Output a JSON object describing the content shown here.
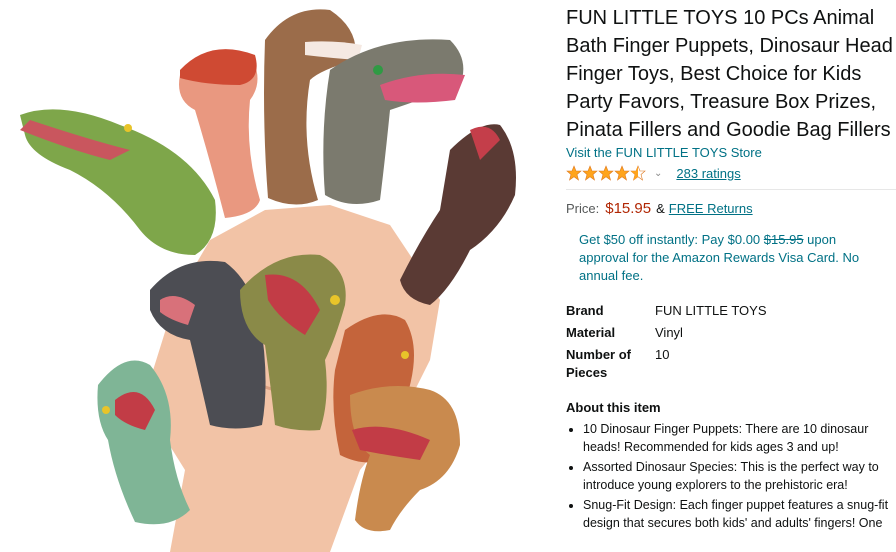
{
  "product": {
    "title": "FUN LITTLE TOYS 10 PCs Animal Bath Finger Puppets, Dinosaur Head Finger Toys, Best Choice for Kids Party Favors, Treasure Box Prizes, Pinata Fillers and Goodie Bag Fillers",
    "store_link": "Visit the FUN LITTLE TOYS Store",
    "rating": 4.5,
    "ratings_count": "283 ratings",
    "chevron_icon": "chevron-down-icon",
    "star_color": "#ffa41c"
  },
  "price": {
    "label": "Price:",
    "amount": "$15.95",
    "amp": "&",
    "returns": "FREE Returns",
    "color": "#b12704"
  },
  "promo": {
    "part1": "Get $50 off instantly: Pay $0.00",
    "strike": "$15.95",
    "part2": "upon approval for the Amazon Rewards Visa Card. No annual fee."
  },
  "specs": [
    {
      "label": "Brand",
      "value": "FUN LITTLE TOYS"
    },
    {
      "label": "Material",
      "value": "Vinyl"
    },
    {
      "label": "Number of Pieces",
      "value": "10"
    }
  ],
  "about": {
    "title": "About this item",
    "bullets": [
      "10 Dinosaur Finger Puppets: There are 10 dinosaur heads! Recommended for kids ages 3 and up!",
      "Assorted Dinosaur Species: This is the perfect way to introduce young explorers to the prehistoric era!",
      "Snug-Fit Design: Each finger puppet features a snug-fit design that secures both kids' and adults' fingers! One"
    ]
  },
  "image": {
    "icon": "product-photo",
    "link_color": "#007185"
  }
}
